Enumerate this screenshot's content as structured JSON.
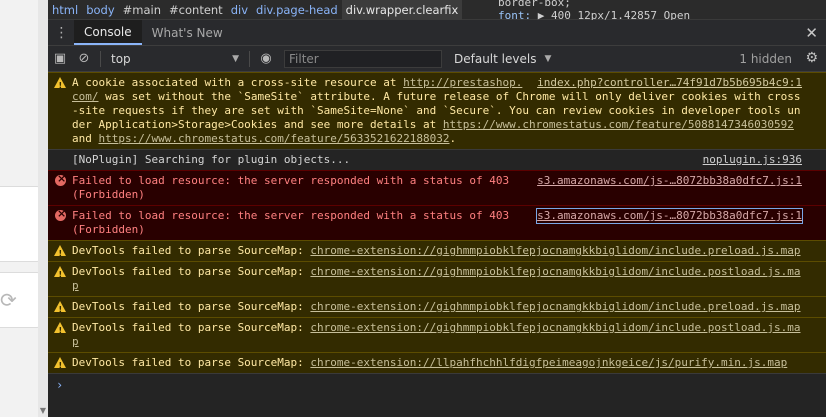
{
  "elements_breadcrumb": [
    "html",
    "body",
    "#main",
    "#content",
    "div",
    "div.page-head",
    "div.wrapper.clearfix"
  ],
  "styles_snippet": {
    "line1": "border-box;",
    "font_prop": "font:",
    "font_value": "▶ 400 12px/1.42857 Open"
  },
  "drawer": {
    "tabs": [
      "Console",
      "What's New"
    ],
    "close": "✕"
  },
  "toolbar": {
    "context": "top",
    "filter_placeholder": "Filter",
    "levels": "Default levels",
    "hidden": "1 hidden"
  },
  "messages": [
    {
      "level": "warn",
      "source": "index.php?controller…74f91d7b5b695b4c9:1",
      "parts": [
        {
          "t": "A cookie associated with a cross-site resource at "
        },
        {
          "t": "http://prestashop.com/",
          "link": true
        },
        {
          "t": " was set without the `SameSite` attribute. A future release of Chrome will only deliver cookies with cross-site requests if they are set with `SameSite=None` and `Secure`. You can review cookies in developer tools under Application>Storage>Cookies and see more details at "
        },
        {
          "t": "https://www.chromestatus.com/feature/5088147346030592",
          "link": true
        },
        {
          "t": " and "
        },
        {
          "t": "https://www.chromestatus.com/feature/5633521622188032",
          "link": true
        },
        {
          "t": "."
        }
      ]
    },
    {
      "level": "info",
      "source": "noplugin.js:936",
      "parts": [
        {
          "t": "[NoPlugin] Searching for plugin objects..."
        }
      ]
    },
    {
      "level": "error",
      "source": "s3.amazonaws.com/js-…8072bb38a0dfc7.js:1",
      "parts": [
        {
          "t": "Failed to load resource: the server responded with a status of 403 (Forbidden)"
        }
      ]
    },
    {
      "level": "error",
      "source": "s3.amazonaws.com/js-…8072bb38a0dfc7.js:1",
      "boxed": true,
      "parts": [
        {
          "t": "Failed to load resource: the server responded with a status of 403 (Forbidden)"
        }
      ]
    },
    {
      "level": "warn",
      "parts": [
        {
          "t": "DevTools failed to parse SourceMap: "
        },
        {
          "t": "chrome-extension://gighmmpiobklfepjocnamgkkbiglidom/include.preload.js.map",
          "link": true
        }
      ]
    },
    {
      "level": "warn",
      "parts": [
        {
          "t": "DevTools failed to parse SourceMap: "
        },
        {
          "t": "chrome-extension://gighmmpiobklfepjocnamgkkbiglidom/include.postload.js.map",
          "link": true
        }
      ]
    },
    {
      "level": "warn",
      "parts": [
        {
          "t": "DevTools failed to parse SourceMap: "
        },
        {
          "t": "chrome-extension://gighmmpiobklfepjocnamgkkbiglidom/include.preload.js.map",
          "link": true
        }
      ]
    },
    {
      "level": "warn",
      "parts": [
        {
          "t": "DevTools failed to parse SourceMap: "
        },
        {
          "t": "chrome-extension://gighmmpiobklfepjocnamgkkbiglidom/include.postload.js.map",
          "link": true
        }
      ]
    },
    {
      "level": "warn",
      "parts": [
        {
          "t": "DevTools failed to parse SourceMap: "
        },
        {
          "t": "chrome-extension://llpahfhchhlfdigfpeimeagojnkgeice/js/purify.min.js.map",
          "link": true
        }
      ]
    }
  ],
  "prompt": "›",
  "colors": {
    "warn_bg": "#332b00",
    "error_bg": "#290000",
    "accent": "#8ab4f8"
  }
}
